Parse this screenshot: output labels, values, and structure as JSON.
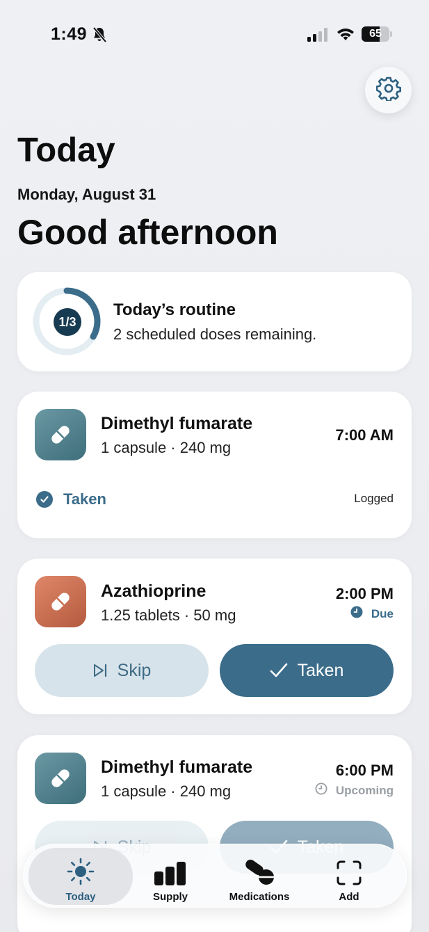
{
  "status_bar": {
    "time": "1:49",
    "battery": "65",
    "battery_level": 0.65
  },
  "header": {
    "title": "Today",
    "date": "Monday, August 31",
    "greeting": "Good afternoon"
  },
  "routine": {
    "title": "Today’s routine",
    "subtitle": "2 scheduled doses remaining.",
    "progress_label": "1/3",
    "progress": 0.333
  },
  "doses": [
    {
      "name": "Dimethyl fumarate",
      "dose": "1 capsule · 240 mg",
      "time": "7:00 AM",
      "status_label": "Taken",
      "status_note": "Logged",
      "icon_color": "#4f7f8b"
    },
    {
      "name": "Azathioprine",
      "dose": "1.25 tablets · 50 mg",
      "time": "2:00 PM",
      "status_label": "Due",
      "skip_label": "Skip",
      "taken_label": "Taken",
      "icon_color": "#c96a4c"
    },
    {
      "name": "Dimethyl fumarate",
      "dose": "1 capsule · 240 mg",
      "time": "6:00 PM",
      "status_label": "Upcoming",
      "skip_label": "Skip",
      "taken_label": "Taken",
      "icon_color": "#4f7f8b"
    }
  ],
  "tabbar": {
    "items": [
      {
        "label": "Today",
        "icon": "sun-icon",
        "active": true
      },
      {
        "label": "Supply",
        "icon": "bar-chart-icon",
        "active": false
      },
      {
        "label": "Medications",
        "icon": "pills-icon",
        "active": false
      },
      {
        "label": "Add",
        "icon": "scan-frame-icon",
        "active": false
      }
    ]
  },
  "colors": {
    "accent": "#3b6c8a",
    "background": "#eef0f4"
  }
}
